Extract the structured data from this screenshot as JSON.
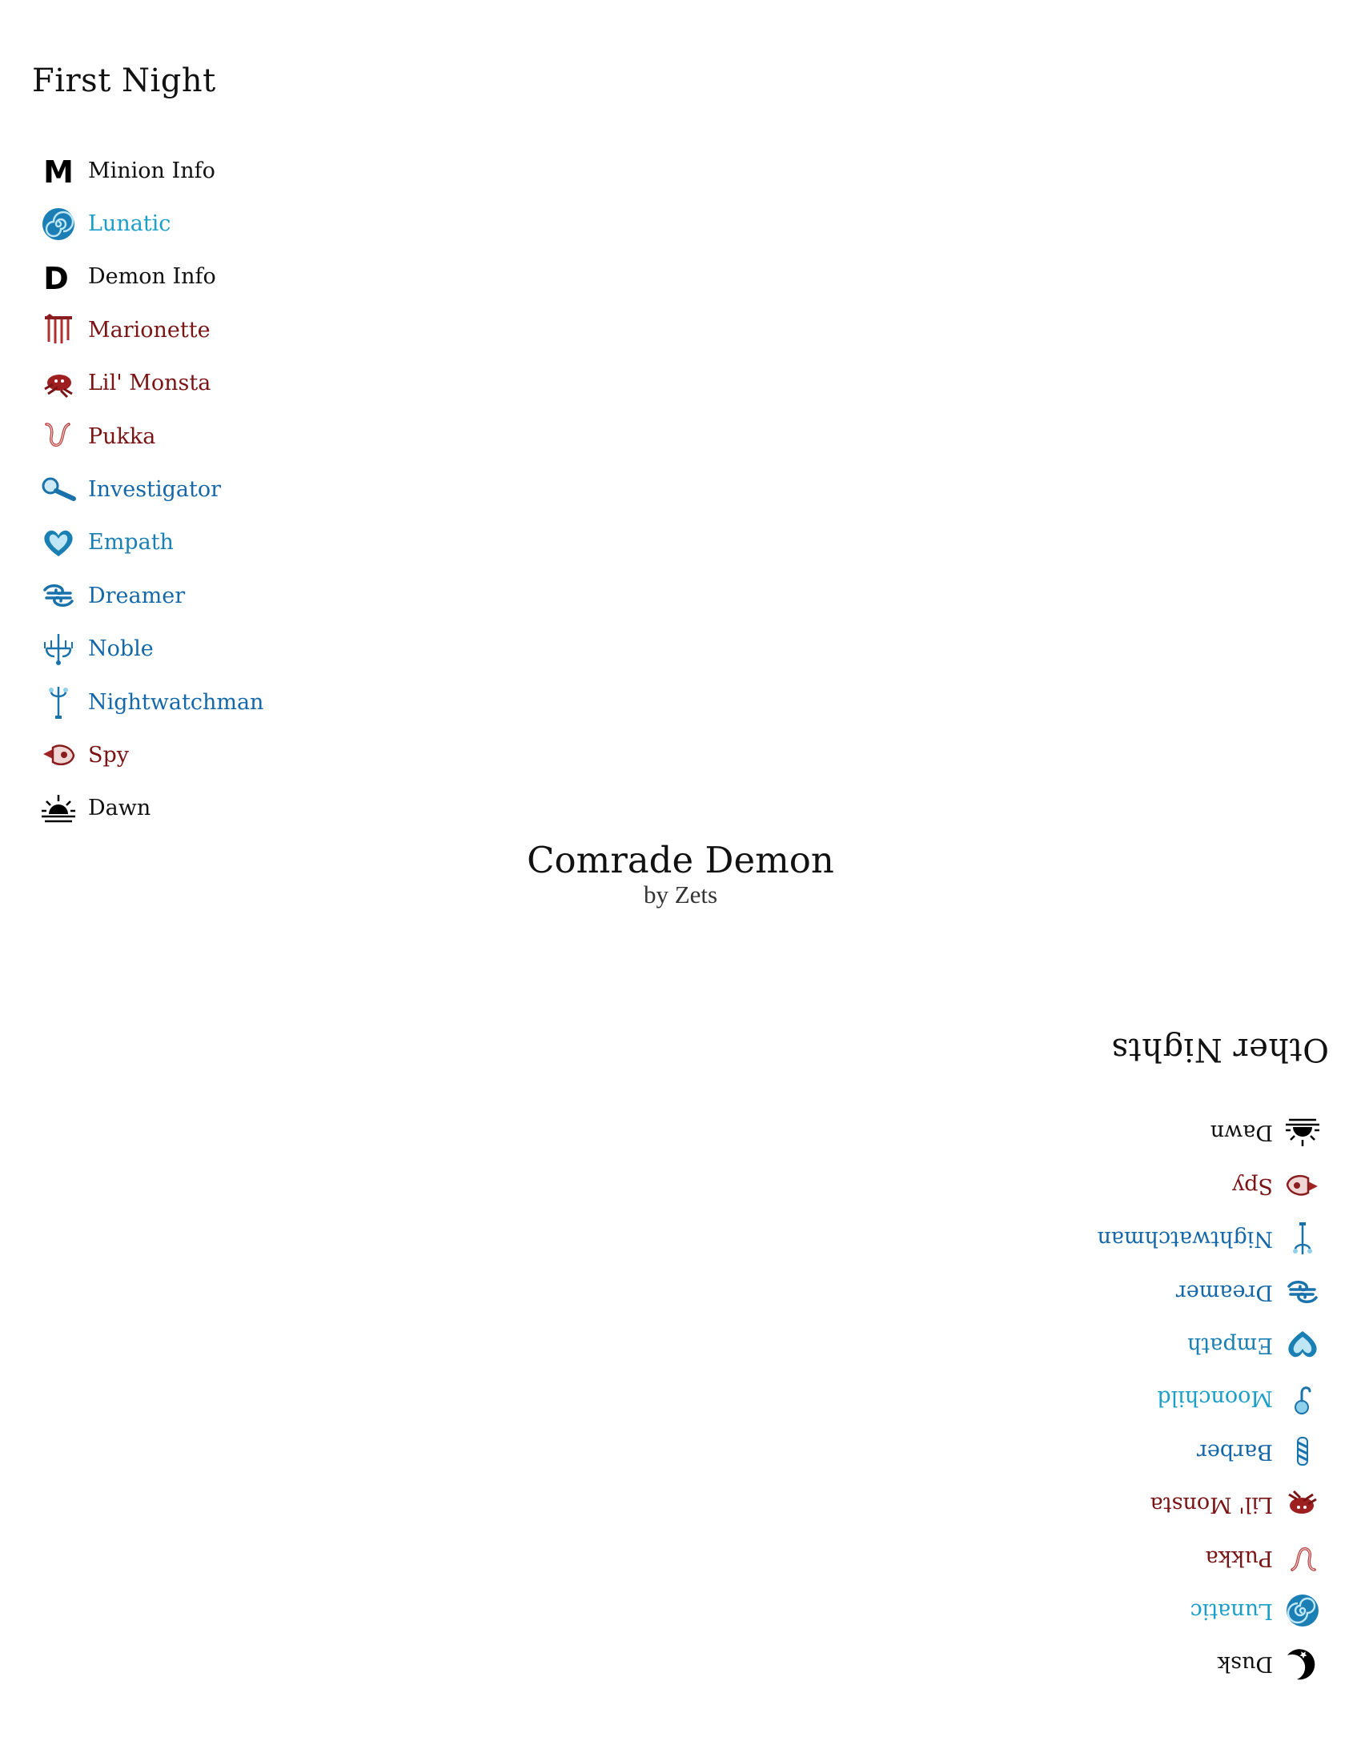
{
  "first_night": {
    "title": "First Night",
    "items": [
      {
        "label": "Minion Info",
        "icon": "minion-info-icon",
        "color": "#111111"
      },
      {
        "label": "Lunatic",
        "icon": "spiral-icon",
        "color": "#1b9ec8"
      },
      {
        "label": "Demon Info",
        "icon": "demon-info-icon",
        "color": "#111111"
      },
      {
        "label": "Marionette",
        "icon": "marionette-icon",
        "color": "#7a1414"
      },
      {
        "label": "Lil' Monsta",
        "icon": "lil-monsta-icon",
        "color": "#7a1414"
      },
      {
        "label": "Pukka",
        "icon": "pukka-icon",
        "color": "#7a1414"
      },
      {
        "label": "Investigator",
        "icon": "magnifier-icon",
        "color": "#1467a8"
      },
      {
        "label": "Empath",
        "icon": "heart-icon",
        "color": "#1a7fb3"
      },
      {
        "label": "Dreamer",
        "icon": "dreamer-icon",
        "color": "#1467a8"
      },
      {
        "label": "Noble",
        "icon": "chandelier-icon",
        "color": "#1467a8"
      },
      {
        "label": "Nightwatchman",
        "icon": "lamp-post-icon",
        "color": "#1467a8"
      },
      {
        "label": "Spy",
        "icon": "spy-icon",
        "color": "#7a1414"
      },
      {
        "label": "Dawn",
        "icon": "sunrise-icon",
        "color": "#111111"
      }
    ]
  },
  "header": {
    "title": "Comrade Demon",
    "author": "by Zets"
  },
  "other_nights": {
    "title": "Other Nights",
    "items": [
      {
        "label": "Dusk",
        "icon": "moon-icon",
        "color": "#111111"
      },
      {
        "label": "Lunatic",
        "icon": "spiral-icon",
        "color": "#1b9ec8"
      },
      {
        "label": "Pukka",
        "icon": "pukka-icon",
        "color": "#7a1414"
      },
      {
        "label": "Lil' Monsta",
        "icon": "lil-monsta-icon",
        "color": "#7a1414"
      },
      {
        "label": "Barber",
        "icon": "barber-pole-icon",
        "color": "#1467a8"
      },
      {
        "label": "Moonchild",
        "icon": "moonchild-icon",
        "color": "#1b9ec8"
      },
      {
        "label": "Empath",
        "icon": "heart-icon",
        "color": "#1a7fb3"
      },
      {
        "label": "Dreamer",
        "icon": "dreamer-icon",
        "color": "#1467a8"
      },
      {
        "label": "Nightwatchman",
        "icon": "lamp-post-icon",
        "color": "#1467a8"
      },
      {
        "label": "Spy",
        "icon": "spy-icon",
        "color": "#7a1414"
      },
      {
        "label": "Dawn",
        "icon": "sunrise-icon",
        "color": "#111111"
      }
    ]
  }
}
